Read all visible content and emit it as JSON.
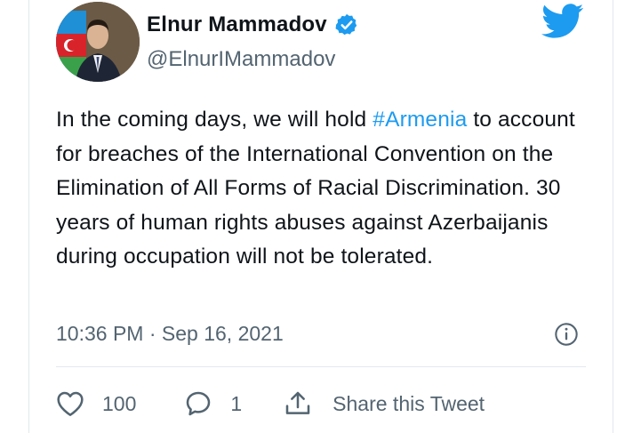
{
  "author": {
    "name": "Elnur Mammadov",
    "handle": "@ElnurIMammadov"
  },
  "tweet": {
    "text_before": "In the coming days, we will hold ",
    "hashtag": "#Armenia",
    "text_after": " to account for breaches of the International Convention on the Elimination of All Forms of Racial Discrimination. 30 years of human rights abuses against Azerbaijanis during occupation will not be tolerated.",
    "timestamp": "10:36 PM · Sep 16, 2021"
  },
  "actions": {
    "likes": "100",
    "replies": "1",
    "share_label": "Share this Tweet"
  },
  "icons": {
    "verified": "verified-badge-icon",
    "brand": "twitter-bird-icon",
    "info": "info-icon",
    "like": "heart-icon",
    "reply": "speech-bubble-icon",
    "share": "share-upload-icon"
  },
  "colors": {
    "accent": "#1d9bf0",
    "text": "#0f1419",
    "muted": "#536471",
    "divider": "#e1e8ed"
  }
}
